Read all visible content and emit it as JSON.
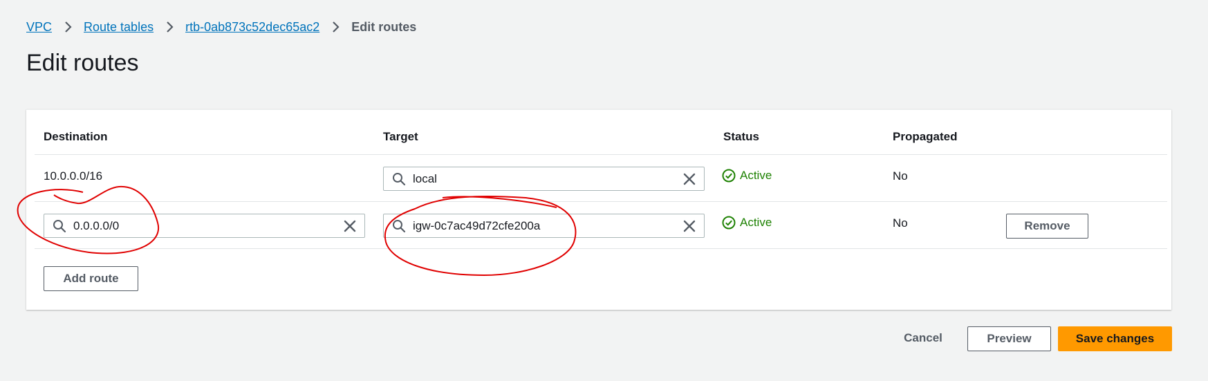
{
  "breadcrumb": {
    "items": [
      {
        "label": "VPC"
      },
      {
        "label": "Route tables"
      },
      {
        "label": "rtb-0ab873c52dec65ac2"
      }
    ],
    "current": "Edit routes"
  },
  "page_title": "Edit routes",
  "table": {
    "headers": {
      "destination": "Destination",
      "target": "Target",
      "status": "Status",
      "propagated": "Propagated"
    },
    "rows": [
      {
        "destination": "10.0.0.0/16",
        "target": "local",
        "status": "Active",
        "propagated": "No"
      },
      {
        "destination": "0.0.0.0/0",
        "target": "igw-0c7ac49d72cfe200a",
        "status": "Active",
        "propagated": "No",
        "remove_label": "Remove"
      }
    ]
  },
  "add_route_label": "Add route",
  "footer": {
    "cancel_label": "Cancel",
    "preview_label": "Preview",
    "save_label": "Save changes"
  },
  "colors": {
    "link": "#0073bb",
    "status_active": "#1d8102",
    "primary_button": "#ff9900",
    "annotation": "#e00000"
  }
}
